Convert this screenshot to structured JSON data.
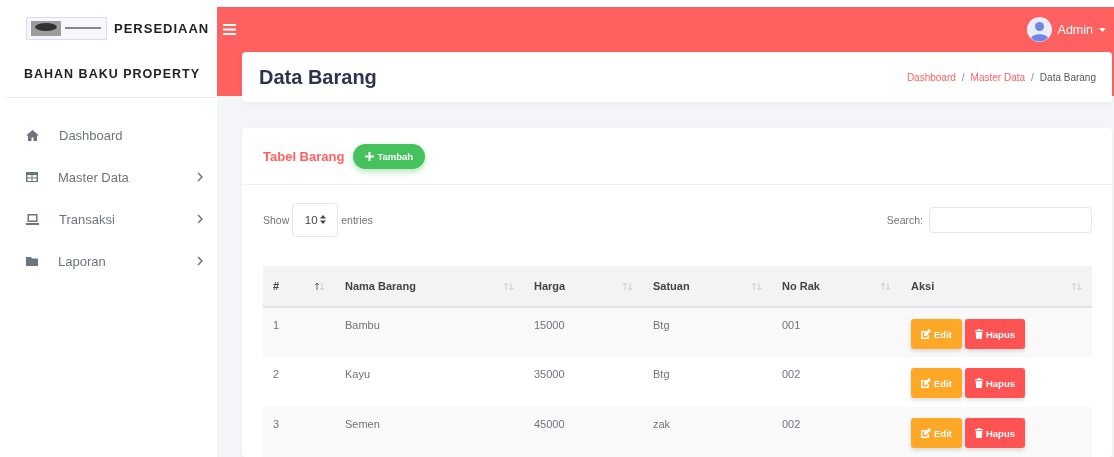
{
  "sidebar": {
    "title": "PERSEDIAAN",
    "subtitle": "BAHAN BAKU PROPERTY",
    "items": [
      {
        "kind": "home",
        "label": "Dashboard",
        "has_children": false
      },
      {
        "kind": "table",
        "label": "Master Data",
        "has_children": true
      },
      {
        "kind": "laptop",
        "label": "Transaksi",
        "has_children": true
      },
      {
        "kind": "folder",
        "label": "Laporan",
        "has_children": true
      }
    ]
  },
  "topbar": {
    "user": "Admin"
  },
  "page": {
    "title": "Data Barang",
    "breadcrumb": [
      {
        "label": "Dashboard",
        "link": true
      },
      {
        "separator": "/",
        "label": "Master Data",
        "link": true
      },
      {
        "separator": "/",
        "label": "Data Barang",
        "link": false
      }
    ]
  },
  "card": {
    "title": "Tabel Barang",
    "add_button": "Tambah"
  },
  "controls": {
    "show_label": "Show",
    "page_size": "10",
    "entries_label": "entries",
    "search_label": "Search:"
  },
  "table": {
    "columns": [
      {
        "label": "#",
        "sorted": true
      },
      {
        "label": "Nama Barang",
        "sorted": false
      },
      {
        "label": "Harga",
        "sorted": false
      },
      {
        "label": "Satuan",
        "sorted": false
      },
      {
        "label": "No Rak",
        "sorted": false
      },
      {
        "label": "Aksi",
        "sorted": false
      }
    ],
    "rows": [
      {
        "cells": [
          "1",
          "Bambu",
          "15000",
          "Btg",
          "001"
        ],
        "actions": [
          "Edit",
          "Hapus"
        ]
      },
      {
        "cells": [
          "2",
          "Kayu",
          "35000",
          "Btg",
          "002"
        ],
        "actions": [
          "Edit",
          "Hapus"
        ]
      },
      {
        "cells": [
          "3",
          "Semen",
          "45000",
          "zak",
          "002"
        ],
        "actions": [
          "Edit",
          "Hapus"
        ]
      }
    ]
  }
}
